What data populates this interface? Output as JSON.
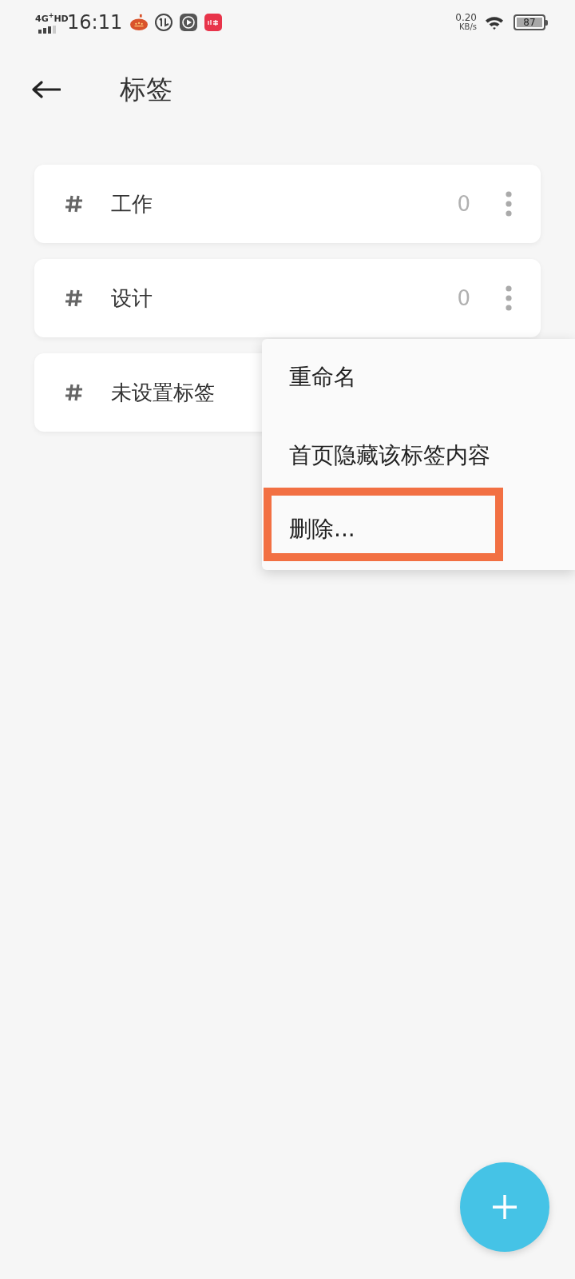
{
  "status_bar": {
    "network": "4G$^{+}$HD",
    "time": "16:11",
    "speed": "0.20",
    "speed_unit": "KB/s",
    "battery": "87"
  },
  "header": {
    "title": "标签"
  },
  "tags": [
    {
      "name": "工作",
      "count": "0"
    },
    {
      "name": "设计",
      "count": "0"
    },
    {
      "name": "未设置标签"
    }
  ],
  "menu": {
    "items": [
      {
        "label": "重命名",
        "highlighted": false
      },
      {
        "label": "首页隐藏该标签内容",
        "highlighted": false
      },
      {
        "label": "删除...",
        "highlighted": true
      }
    ]
  }
}
